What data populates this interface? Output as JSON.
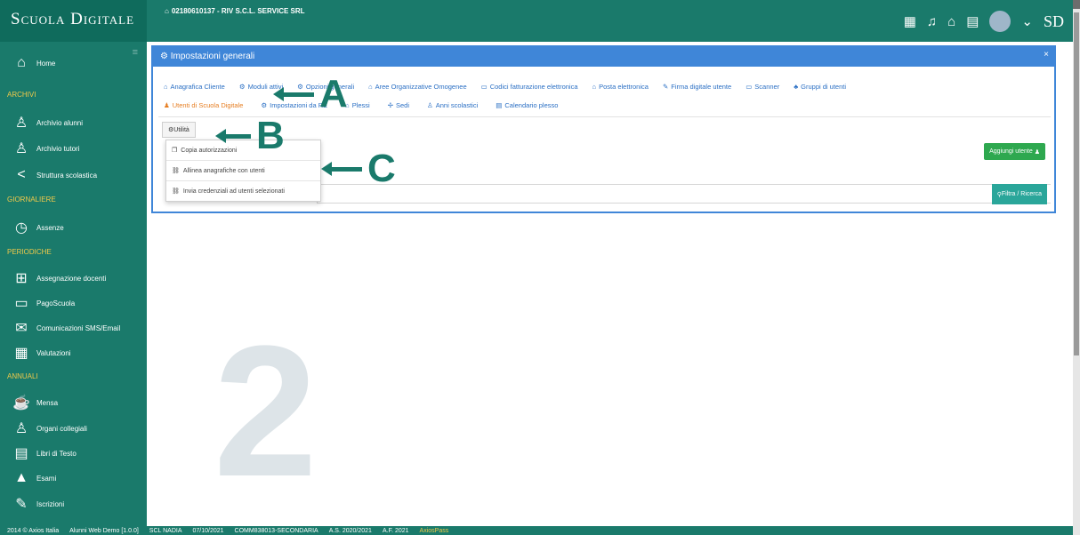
{
  "app": {
    "brand": "Scuola Digitale",
    "company": "02180610137 - RIV S.C.L. SERVICE SRL"
  },
  "topbar": {
    "icons": [
      "building-icon",
      "bell-icon",
      "home-icon",
      "calendar-icon"
    ],
    "logo": "SD",
    "caret": "⌄"
  },
  "sidebar": {
    "toggle": "≡",
    "items": [
      {
        "label": "Home",
        "icon": "home-icon",
        "glyph": "⌂"
      },
      {
        "section": "ARCHIVI"
      },
      {
        "label": "Archivio alunni",
        "icon": "user-icon",
        "glyph": "♙"
      },
      {
        "label": "Archivio tutori",
        "icon": "users-icon",
        "glyph": "♙"
      },
      {
        "label": "Struttura scolastica",
        "icon": "share-icon",
        "glyph": "<"
      },
      {
        "section": "GIORNALIERE"
      },
      {
        "label": "Assenze",
        "icon": "clock-icon",
        "glyph": "◷"
      },
      {
        "section": "PERIODICHE"
      },
      {
        "label": "Assegnazione docenti",
        "icon": "desk-icon",
        "glyph": "⊞"
      },
      {
        "label": "PagoScuola",
        "icon": "wallet-icon",
        "glyph": "▭"
      },
      {
        "label": "Comunicazioni SMS/Email",
        "icon": "mail-icon",
        "glyph": "✉"
      },
      {
        "label": "Valutazioni",
        "icon": "grid-icon",
        "glyph": "▦"
      },
      {
        "section": "ANNUALI"
      },
      {
        "label": "Mensa",
        "icon": "cup-icon",
        "glyph": "☕"
      },
      {
        "label": "Organi collegiali",
        "icon": "people-icon",
        "glyph": "♙"
      },
      {
        "label": "Libri di Testo",
        "icon": "book-icon",
        "glyph": "▤"
      },
      {
        "label": "Esami",
        "icon": "cap-icon",
        "glyph": "▲"
      },
      {
        "label": "Iscrizioni",
        "icon": "edit-icon",
        "glyph": "✎"
      }
    ]
  },
  "panel": {
    "title": "Impostazioni generali",
    "close": "×",
    "tabs_row1": [
      {
        "label": "Anagrafica Cliente",
        "icon": "⌂"
      },
      {
        "label": "Moduli attivi",
        "icon": "⚙"
      },
      {
        "label": "Opzioni generali",
        "icon": "⚙"
      },
      {
        "label": "Aree Organizzative Omogenee",
        "icon": "⌂"
      },
      {
        "label": "Codici fatturazione elettronica",
        "icon": "▭"
      },
      {
        "label": "Posta elettronica",
        "icon": "⌂"
      },
      {
        "label": "Firma digitale utente",
        "icon": "✎"
      },
      {
        "label": "Scanner",
        "icon": "▭"
      },
      {
        "label": "Gruppi di utenti",
        "icon": "♣"
      }
    ],
    "tabs_row2": [
      {
        "label": "Utenti di Scuola Digitale",
        "icon": "♟",
        "active": true
      },
      {
        "label": "Impostazioni da RE",
        "icon": "⚙"
      },
      {
        "label": "Plessi",
        "icon": "⌂"
      },
      {
        "label": "Sedi",
        "icon": "✢"
      },
      {
        "label": "Anni scolastici",
        "icon": "♙"
      },
      {
        "label": "Calendario plesso",
        "icon": "▤"
      }
    ],
    "utility_button": "Utilità",
    "add_user_button": "Aggiungi utente",
    "filter_button": "Filtra / Ricerca",
    "dropdown": [
      {
        "label": "Copia autorizzazioni",
        "icon": "copy-icon",
        "glyph": "❐"
      },
      {
        "label": "Allinea anagrafiche con utenti",
        "icon": "link-icon",
        "glyph": "⛓"
      },
      {
        "label": "Invia credenziali ad utenti selezionati",
        "icon": "link-icon",
        "glyph": "⛓"
      }
    ]
  },
  "annotations": {
    "a": "A",
    "b": "B",
    "c": "C",
    "watermark": "2"
  },
  "footer": {
    "copyright": "2014 © Axios Italia",
    "version": "Alunni Web Demo [1.0.0]",
    "user": "SCL NADIA",
    "date": "07/10/2021",
    "school": "COMM838013-SECONDARIA",
    "school_year": "A.S. 2020/2021",
    "fiscal_year": "A.F. 2021",
    "pass": "AxiosPass"
  },
  "colors": {
    "primary": "#1a7a6b",
    "accent": "#3f86d8",
    "active_tab": "#e67e22",
    "add": "#2ea84f"
  }
}
